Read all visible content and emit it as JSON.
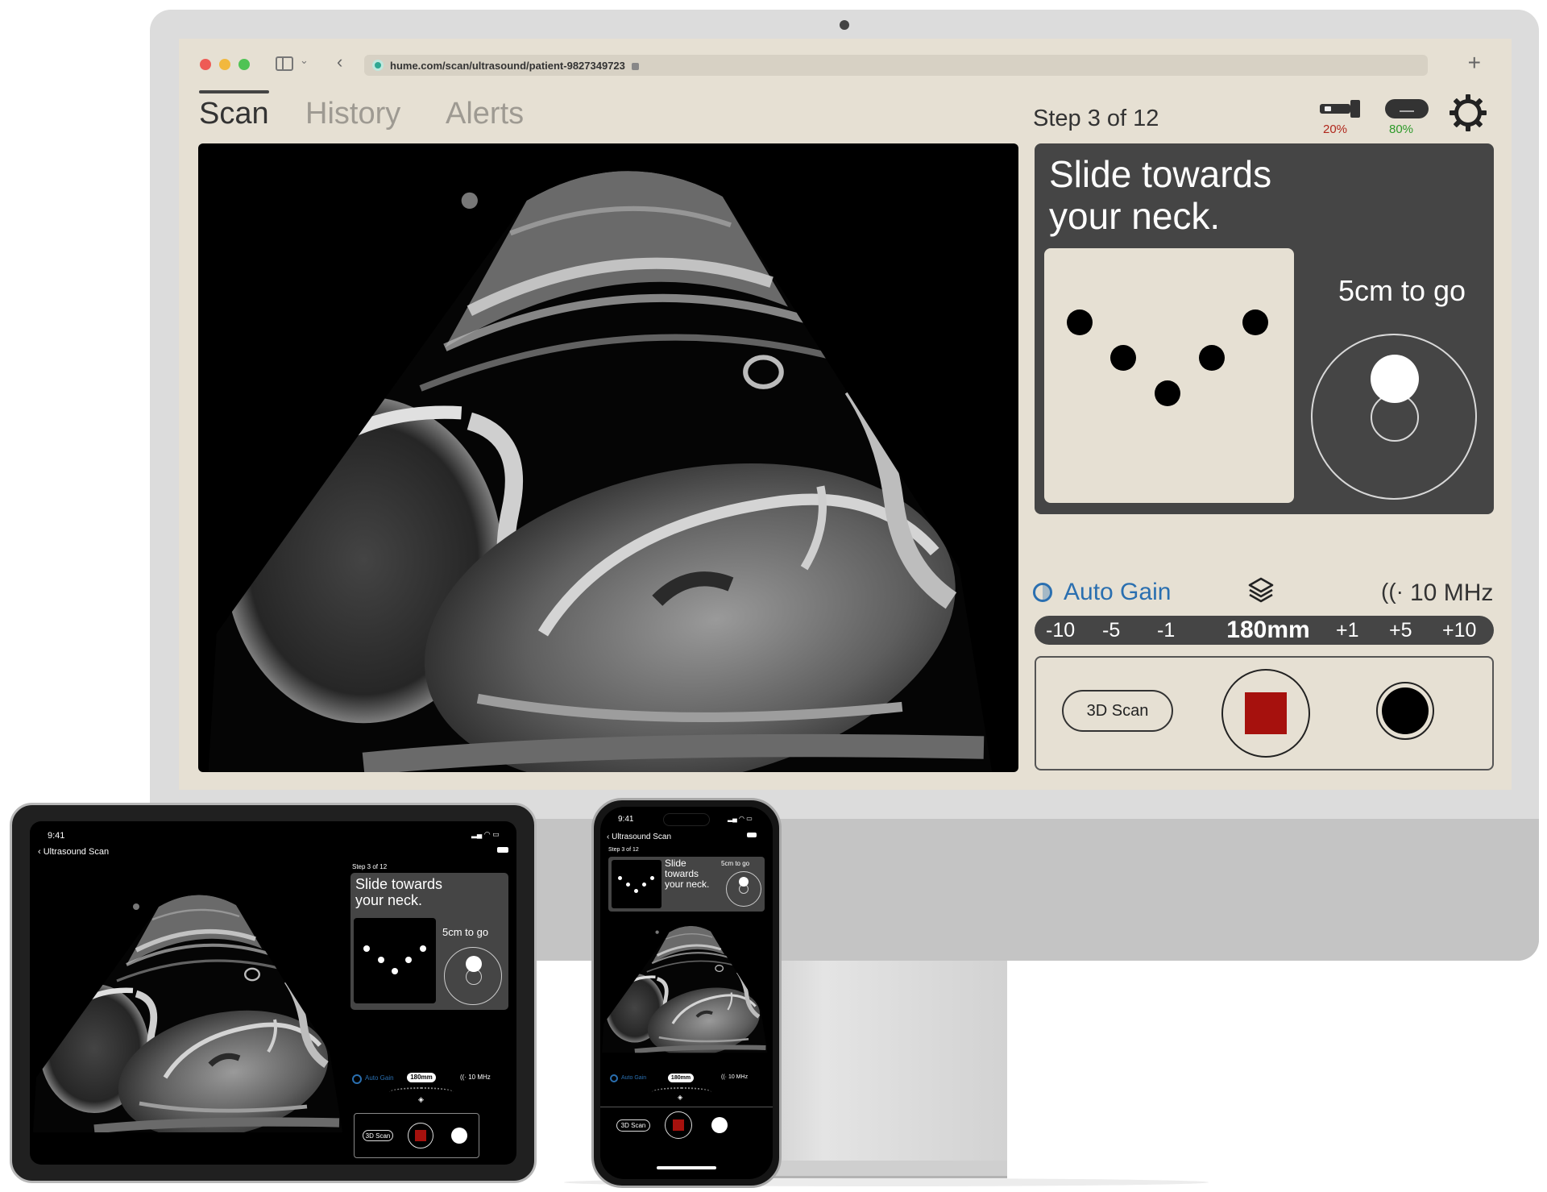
{
  "browser": {
    "url": "hume.com/scan/ultrasound/patient-9827349723",
    "new_tab": "+"
  },
  "tabs": [
    {
      "label": "Scan",
      "active": true
    },
    {
      "label": "History",
      "active": false
    },
    {
      "label": "Alerts",
      "active": false
    }
  ],
  "step": "Step 3 of 12",
  "status": {
    "probe_battery": "20%",
    "device_battery": "80%",
    "probe_color": "#b0271c",
    "device_color": "#2d9a2a"
  },
  "guidance": {
    "instruction": "Slide towards your neck.",
    "distance": "5cm to go"
  },
  "controls": {
    "auto_gain": "Auto Gain",
    "frequency": "10 MHz",
    "depth_ticks": [
      "-10",
      "-5",
      "-1",
      "+1",
      "+5",
      "+10"
    ],
    "depth_value": "180mm",
    "scan_3d": "3D Scan",
    "record_color": "#a6110d",
    "accent": "#2a6fb0"
  },
  "ipad": {
    "time": "9:41",
    "back": "Ultrasound Scan",
    "step": "Step 3 of 12",
    "instruction": "Slide towards your neck.",
    "distance": "5cm to go",
    "auto_gain": "Auto Gain",
    "depth": "180mm",
    "frequency": "10 MHz",
    "scan_3d": "3D Scan"
  },
  "iphone": {
    "time": "9:41",
    "back": "Ultrasound Scan",
    "step": "Step 3 of 12",
    "instruction": "Slide towards your neck.",
    "distance": "5cm to go",
    "auto_gain": "Auto Gain",
    "depth": "180mm",
    "frequency": "10 MHz",
    "scan_3d": "3D Scan"
  }
}
